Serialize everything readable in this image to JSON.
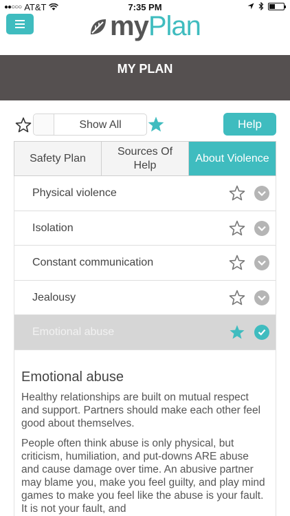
{
  "status_bar": {
    "carrier": "AT&T",
    "signal_dots": "●●○○○",
    "time": "7:35 PM",
    "battery_level": 0.4
  },
  "header": {
    "logo_prefix": "my",
    "logo_suffix": "Plan",
    "title": "MY PLAN"
  },
  "toolbar": {
    "show_all_label": "Show All",
    "help_label": "Help"
  },
  "tabs": [
    {
      "label": "Safety Plan",
      "active": false
    },
    {
      "label": "Sources Of Help",
      "active": false
    },
    {
      "label": "About Violence",
      "active": true
    }
  ],
  "items": [
    {
      "label": "Physical violence",
      "starred": false,
      "checked": false
    },
    {
      "label": "Isolation",
      "starred": false,
      "checked": false
    },
    {
      "label": "Constant communication",
      "starred": false,
      "checked": false
    },
    {
      "label": "Jealousy",
      "starred": false,
      "checked": false
    },
    {
      "label": "Emotional abuse",
      "starred": true,
      "checked": true,
      "selected": true
    }
  ],
  "detail": {
    "title": "Emotional abuse",
    "paragraph1": "Healthy relationships are built on mutual respect and support. Partners should make each other feel good about themselves.",
    "paragraph2": "People often think abuse is only physical, but criticism, humiliation, and put-downs ARE abuse and cause damage over time. An abusive partner may blame you, make you feel guilty, and play mind games to make you feel like the abuse is your fault. It is not your fault, and"
  },
  "colors": {
    "accent": "#3fbcbf",
    "title_bar": "#555050",
    "selected_row": "#d6d6d6",
    "check_inactive": "#b5b5b5"
  }
}
